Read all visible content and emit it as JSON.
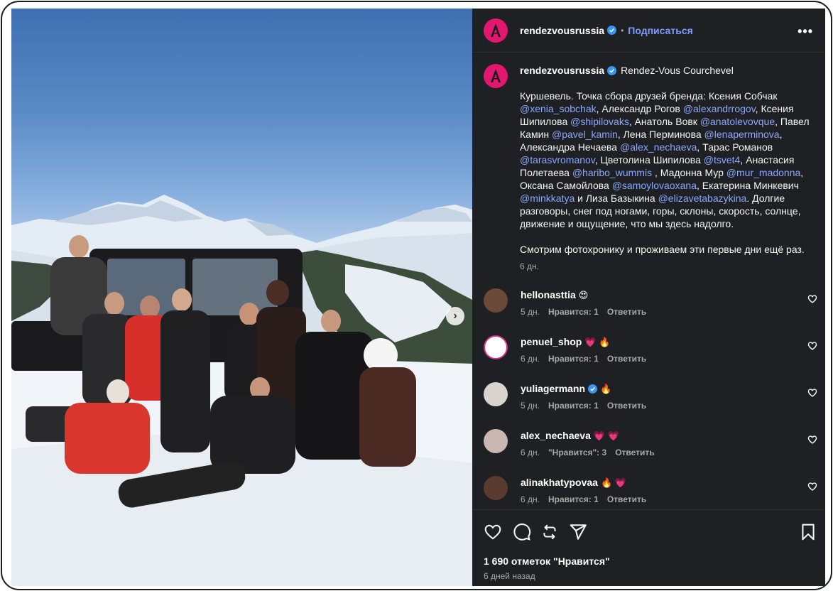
{
  "header": {
    "username": "rendezvousrussia",
    "separator": "•",
    "follow_label": "Подписаться",
    "more_label": "•••",
    "brand_color": "#e2176f",
    "link_color": "#7b9cff"
  },
  "caption": {
    "username": "rendezvousrussia",
    "location": "Rendez-Vous Courchevel",
    "segments": [
      {
        "t": "Куршевель. Точка сбора друзей бренда: Ксения Собчак "
      },
      {
        "t": "@xenia_sobchak",
        "m": true
      },
      {
        "t": ", Александр Рогов "
      },
      {
        "t": "@alexandrrogov",
        "m": true
      },
      {
        "t": ", Ксения Шипилова "
      },
      {
        "t": "@shipilovaks",
        "m": true
      },
      {
        "t": ", Анатоль Вовк "
      },
      {
        "t": "@anatolevovque",
        "m": true
      },
      {
        "t": ", Павел Камин "
      },
      {
        "t": "@pavel_kamin",
        "m": true
      },
      {
        "t": ", Лена Перминова "
      },
      {
        "t": "@lenaperminova",
        "m": true
      },
      {
        "t": ", Александра Нечаева "
      },
      {
        "t": "@alex_nechaeva",
        "m": true
      },
      {
        "t": ", Тарас Романов "
      },
      {
        "t": "@tarasvromanov",
        "m": true
      },
      {
        "t": ", Цветолина Шипилова "
      },
      {
        "t": "@tsvet4",
        "m": true
      },
      {
        "t": ", Анастасия Полетаева "
      },
      {
        "t": "@haribo_wummis",
        "m": true
      },
      {
        "t": " , Мадонна Мур "
      },
      {
        "t": "@mur_madonna",
        "m": true
      },
      {
        "t": ", Оксана Самойлова "
      },
      {
        "t": "@samoylovaoxana",
        "m": true
      },
      {
        "t": ", Екатерина Минкевич "
      },
      {
        "t": "@minkkatya",
        "m": true
      },
      {
        "t": " и Лиза Базыкина "
      },
      {
        "t": "@elizavetabazykina",
        "m": true
      },
      {
        "t": ". Долгие разговоры, снег под ногами, горы, склоны, скорость, солнце, движение и ощущение, что мы здесь надолго."
      }
    ],
    "second_paragraph": "Смотрим фотохронику и проживаем эти первые дни ещё раз.",
    "time": "6 дн."
  },
  "comments": [
    {
      "user": "hellonasttia",
      "emoji": "😍",
      "time": "5 дн.",
      "likes": "Нравится: 1",
      "reply": "Ответить",
      "verified": false
    },
    {
      "user": "penuel_shop",
      "emoji": "💗 🔥",
      "time": "6 дн.",
      "likes": "Нравится: 1",
      "reply": "Ответить",
      "verified": false
    },
    {
      "user": "yuliagermann",
      "emoji": "🔥",
      "time": "5 дн.",
      "likes": "Нравится: 1",
      "reply": "Ответить",
      "verified": true
    },
    {
      "user": "alex_nechaeva",
      "emoji": "💗 💗",
      "time": "6 дн.",
      "likes": "\"Нравится\": 3",
      "reply": "Ответить",
      "verified": false
    },
    {
      "user": "alinakhatypovaa",
      "emoji": "🔥 💗",
      "time": "6 дн.",
      "likes": "Нравится: 1",
      "reply": "Ответить",
      "verified": false
    }
  ],
  "footer": {
    "likes": "1 690 отметок \"Нравится\"",
    "ago": "6 дней назад"
  },
  "icons": {
    "verified": "verified-badge-icon",
    "like": "heart-icon",
    "comment": "comment-icon",
    "share": "repost-icon",
    "send": "send-icon",
    "save": "bookmark-icon",
    "next": "chevron-right-icon"
  },
  "colors": {
    "panel_bg": "#1f2023",
    "verified": "#3897f0"
  }
}
